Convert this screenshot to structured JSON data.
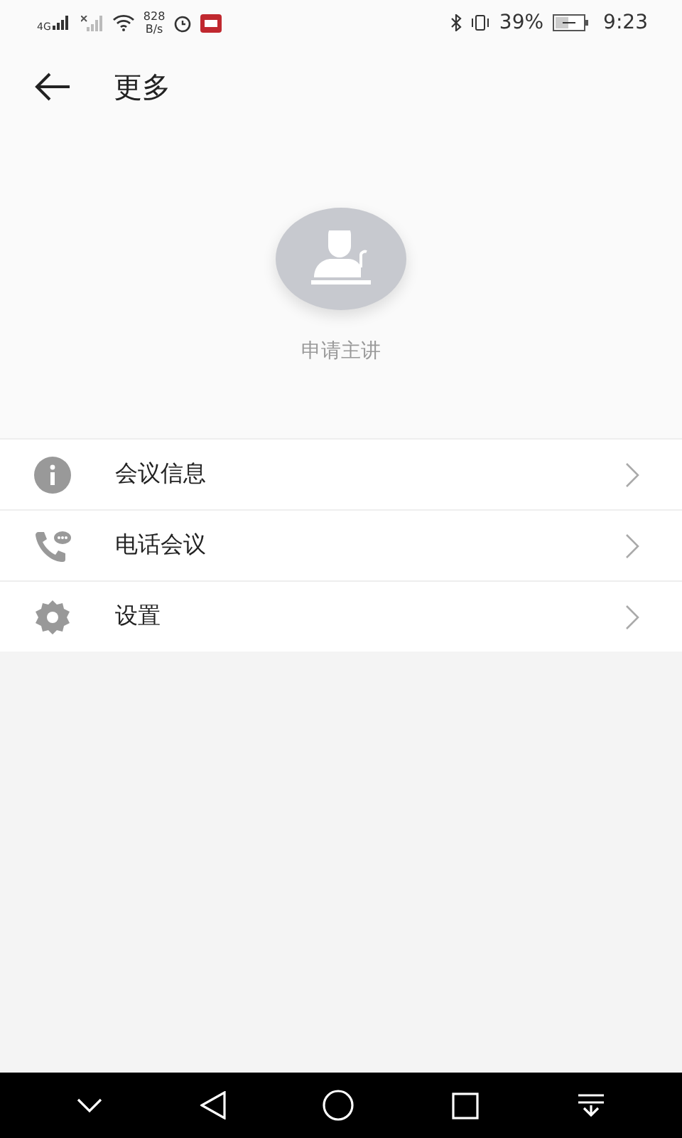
{
  "status_bar": {
    "network": "4G",
    "speed_value": "828",
    "speed_unit": "B/s",
    "battery": "39%",
    "time": "9:23"
  },
  "header": {
    "title": "更多"
  },
  "speaker_request": {
    "label": "申请主讲"
  },
  "menu": [
    {
      "kind": "info",
      "label": "会议信息"
    },
    {
      "kind": "phone",
      "label": "电话会议"
    },
    {
      "kind": "settings",
      "label": "设置"
    }
  ]
}
